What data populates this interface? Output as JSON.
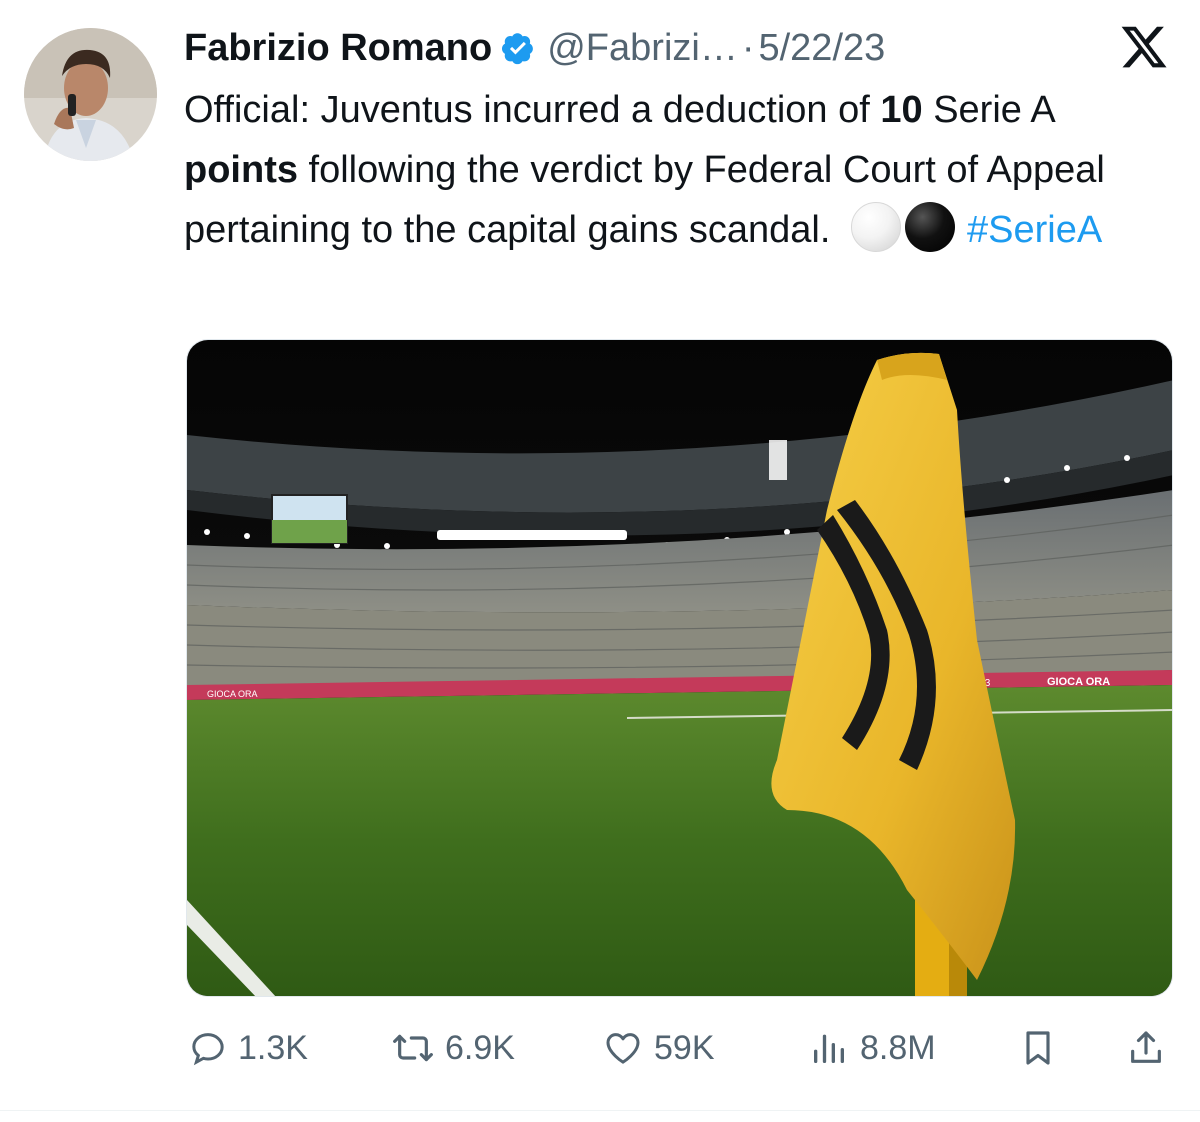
{
  "tweet": {
    "author": {
      "display_name": "Fabrizio Romano",
      "handle": "@Fabrizi…",
      "verified": true
    },
    "separator": "·",
    "date": "5/22/23",
    "text": {
      "p1": "Official: Juventus incurred a deduction of ",
      "b1": "10",
      "p2": " Serie A ",
      "b2": "points",
      "p3": " following the verdict by Federal Court of Appeal pertaining to the capital gains scandal. ",
      "hashtag": "#SerieA"
    },
    "media": {
      "alt": "Juventus stadium corner flag",
      "board_texts": [
        "GIOCA ORA",
        "FA23",
        "GIOCA ORA"
      ]
    },
    "actions": {
      "replies": "1.3K",
      "reposts": "6.9K",
      "likes": "59K",
      "views": "8.8M"
    }
  },
  "icons": {
    "logo": "x-logo-icon",
    "verified": "verified-badge-icon",
    "reply": "reply-icon",
    "repost": "repost-icon",
    "like": "heart-icon",
    "views": "views-icon",
    "bookmark": "bookmark-icon",
    "share": "share-icon"
  },
  "colors": {
    "text": "#0f1419",
    "secondary": "#536471",
    "link": "#1d9bf0",
    "verified": "#1d9bf0",
    "flag": "#f2c230"
  }
}
